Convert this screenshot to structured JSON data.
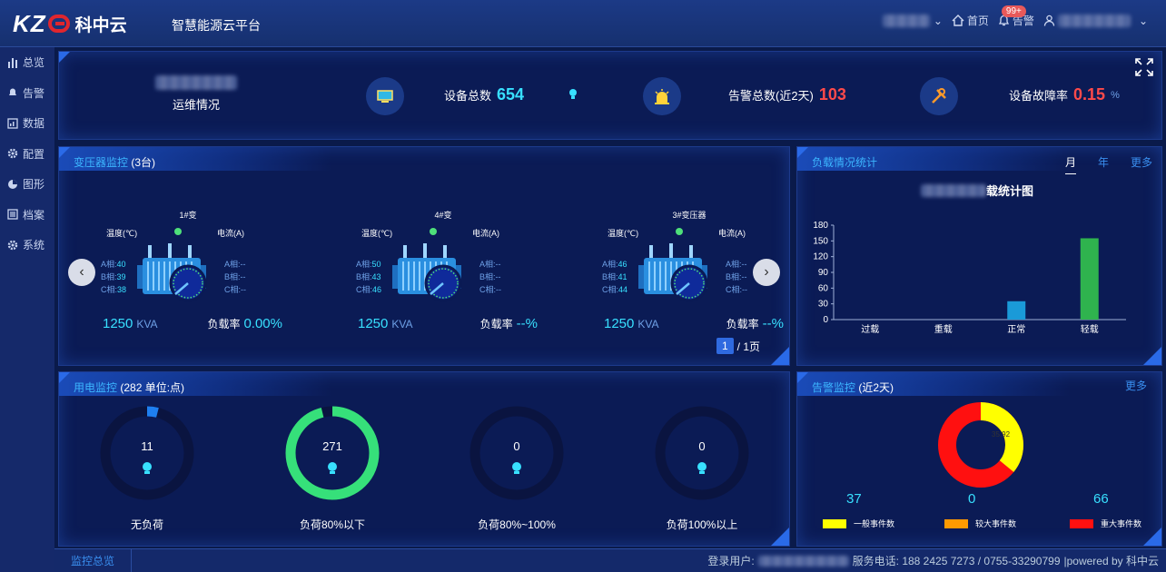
{
  "header": {
    "brand": "科中云",
    "subtitle": "智慧能源云平台",
    "home": "首页",
    "alarm": "告警",
    "alarm_badge": "99+"
  },
  "sidebar": {
    "items": [
      {
        "label": "总览",
        "icon": "bar-chart-icon"
      },
      {
        "label": "告警",
        "icon": "bell-icon"
      },
      {
        "label": "数据",
        "icon": "data-icon"
      },
      {
        "label": "配置",
        "icon": "gear-icon"
      },
      {
        "label": "图形",
        "icon": "pie-icon"
      },
      {
        "label": "档案",
        "icon": "archive-icon"
      },
      {
        "label": "系统",
        "icon": "system-icon"
      }
    ]
  },
  "summary": {
    "ops_label": "运维情况",
    "device_total_label": "设备总数",
    "device_total": "654",
    "alarm_total_label": "告警总数(近2天)",
    "alarm_total": "103",
    "fault_rate_label": "设备故障率",
    "fault_rate": "0.15",
    "fault_unit": "%"
  },
  "transformer": {
    "title": "变压器监控",
    "count": "(3台)",
    "temp_label": "温度(℃)",
    "current_label": "电流(A)",
    "units": [
      {
        "name": "1#变",
        "ta": "40",
        "tb": "39",
        "tc": "38",
        "ia": "--",
        "ib": "--",
        "ic": "--",
        "kva": "1250",
        "rate": "0.00%"
      },
      {
        "name": "4#变",
        "ta": "50",
        "tb": "43",
        "tc": "46",
        "ia": "--",
        "ib": "--",
        "ic": "--",
        "kva": "1250",
        "rate": "--%"
      },
      {
        "name": "3#变压器",
        "ta": "46",
        "tb": "41",
        "tc": "44",
        "ia": "--",
        "ib": "--",
        "ic": "--",
        "kva": "1250",
        "rate": "--%"
      }
    ],
    "phase_a": "A相:",
    "phase_b": "B相:",
    "phase_c": "C相:",
    "kva_unit": "KVA",
    "rate_label": "负载率",
    "page": "1",
    "page_total": "/ 1页"
  },
  "load": {
    "title": "负载情况统计",
    "tab_month": "月",
    "tab_year": "年",
    "tab_more": "更多",
    "chart_title_suffix": "载统计图"
  },
  "chart_data": {
    "type": "bar",
    "categories": [
      "过载",
      "重载",
      "正常",
      "轻载"
    ],
    "values": [
      0,
      0,
      35,
      155
    ],
    "colors": [
      "#1a9ad8",
      "#1a9ad8",
      "#1a9ad8",
      "#2fb34e"
    ],
    "ylim": [
      0,
      180
    ],
    "yticks": [
      "0",
      "30",
      "60",
      "90",
      "120",
      "150",
      "180"
    ]
  },
  "power": {
    "title": "用电监控",
    "count": "(282 单位:点)",
    "rings": [
      {
        "value": "11",
        "label": "无负荷",
        "frac": 0.04,
        "color": "#1e7ff0"
      },
      {
        "value": "271",
        "label": "负荷80%以下",
        "frac": 0.96,
        "color": "#36e07a"
      },
      {
        "value": "0",
        "label": "负荷80%~100%",
        "frac": 0,
        "color": "#36e07a"
      },
      {
        "value": "0",
        "label": "负荷100%以上",
        "frac": 0,
        "color": "#36e07a"
      }
    ]
  },
  "alarm": {
    "title": "告警监控",
    "period": "(近2天)",
    "more": "更多",
    "donut_label": "35.92",
    "items": [
      {
        "count": "37",
        "label": "一般事件数",
        "color": "#ffff00"
      },
      {
        "count": "0",
        "label": "较大事件数",
        "color": "#ff9a00"
      },
      {
        "count": "66",
        "label": "重大事件数",
        "color": "#ff1010"
      }
    ]
  },
  "footer": {
    "tab": "监控总览",
    "login": "登录用户:",
    "service": "服务电话: 188 2425 7273 / 0755-33290799",
    "powered": "|powered by 科中云"
  }
}
